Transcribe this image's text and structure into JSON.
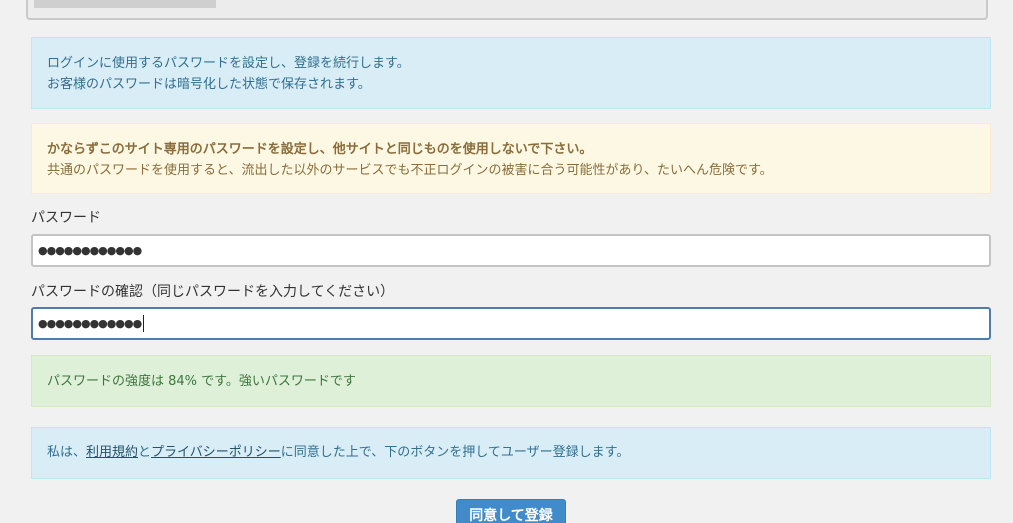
{
  "info_notice": {
    "line1": "ログインに使用するパスワードを設定し、登録を続行します。",
    "line2": "お客様のパスワードは暗号化した状態で保存されます。"
  },
  "warning_notice": {
    "title": "かならずこのサイト専用のパスワードを設定し、他サイトと同じものを使用しないで下さい。",
    "body": "共通のパスワードを使用すると、流出した以外のサービスでも不正ログインの被害に合う可能性があり、たいへん危険です。"
  },
  "password_field": {
    "label": "パスワード",
    "value": "●●●●●●●●●●●●"
  },
  "confirm_field": {
    "label": "パスワードの確認（同じパスワードを入力してください）",
    "value": "●●●●●●●●●●●●"
  },
  "strength": {
    "text": "パスワードの強度は 84% です。強いパスワードです"
  },
  "agreement": {
    "prefix": "私は、",
    "terms_link": "利用規約",
    "and": "と",
    "privacy_link": "プライバシーポリシー",
    "suffix": "に同意した上で、下のボタンを押してユーザー登録します。"
  },
  "submit": {
    "label": "同意して登録"
  }
}
